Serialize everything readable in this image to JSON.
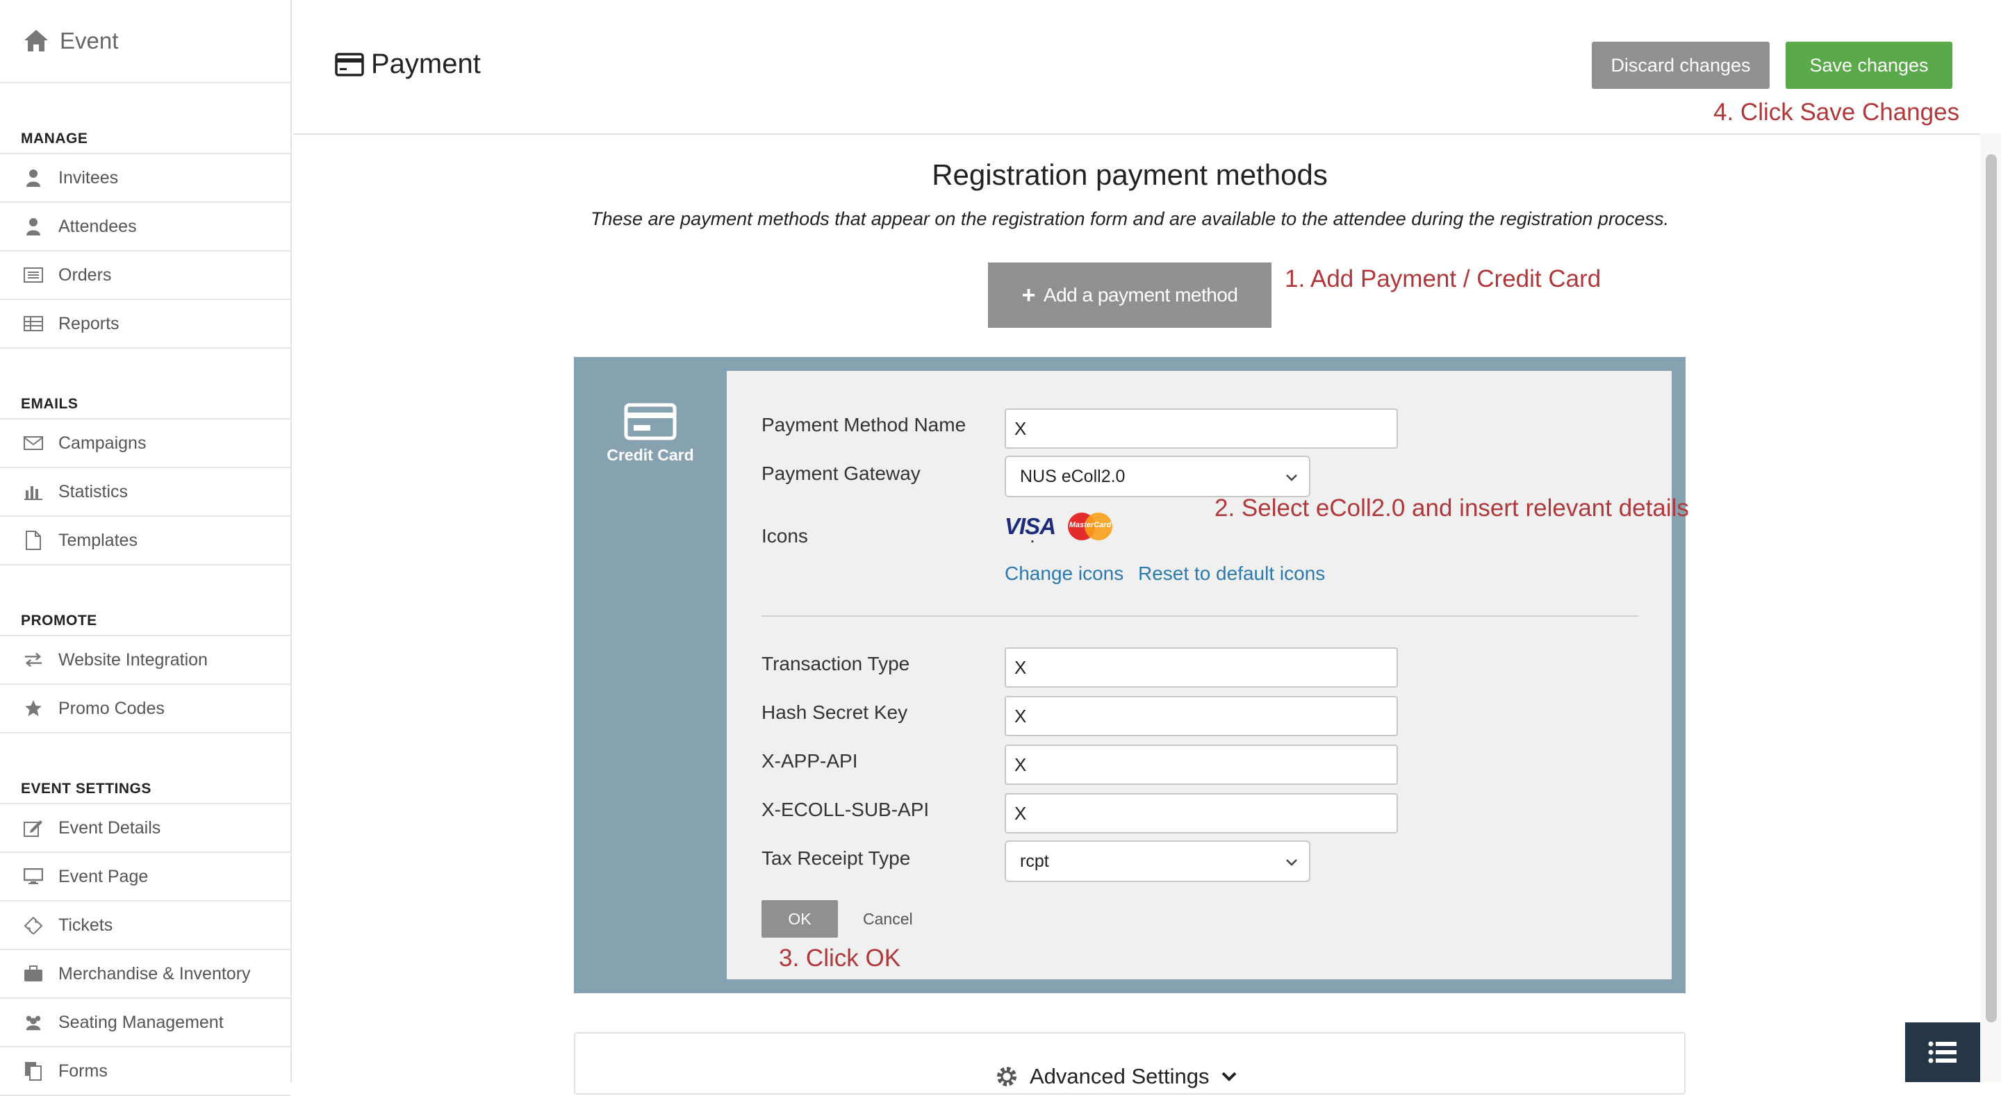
{
  "sidebar": {
    "brand": "Event",
    "sections": [
      {
        "title": "MANAGE",
        "items": [
          "Invitees",
          "Attendees",
          "Orders",
          "Reports"
        ]
      },
      {
        "title": "EMAILS",
        "items": [
          "Campaigns",
          "Statistics",
          "Templates"
        ]
      },
      {
        "title": "PROMOTE",
        "items": [
          "Website Integration",
          "Promo Codes"
        ]
      },
      {
        "title": "EVENT SETTINGS",
        "items": [
          "Event Details",
          "Event Page",
          "Tickets",
          "Merchandise & Inventory",
          "Seating Management",
          "Forms"
        ]
      }
    ]
  },
  "header": {
    "title": "Payment",
    "discard_label": "Discard changes",
    "save_label": "Save changes"
  },
  "annotations": {
    "step1": "1. Add Payment / Credit Card",
    "step2": "2. Select eColl2.0 and insert relevant details",
    "step3": "3. Click OK",
    "step4": "4. Click Save Changes"
  },
  "main": {
    "heading": "Registration payment methods",
    "description": "These are payment methods that appear on the registration form and are available to the attendee during the registration process.",
    "add_button": "Add a payment method",
    "method_tab_label": "Credit Card",
    "form": {
      "payment_method_name": {
        "label": "Payment Method Name",
        "value": "X"
      },
      "payment_gateway": {
        "label": "Payment Gateway",
        "value": "NUS eColl2.0"
      },
      "icons": {
        "label": "Icons",
        "visa": "VISA",
        "mastercard": "MasterCard",
        "change_link": "Change icons",
        "reset_link": "Reset to default icons"
      },
      "transaction_type": {
        "label": "Transaction Type",
        "value": "X"
      },
      "hash_secret_key": {
        "label": "Hash Secret Key",
        "value": "X"
      },
      "x_app_api": {
        "label": "X-APP-API",
        "value": "X"
      },
      "x_ecoll_sub_api": {
        "label": "X-ECOLL-SUB-API",
        "value": "X"
      },
      "tax_receipt_type": {
        "label": "Tax Receipt Type",
        "value": "rcpt"
      },
      "colon": ":",
      "ok_label": "OK",
      "cancel_label": "Cancel"
    },
    "advanced_settings": "Advanced Settings"
  },
  "colors": {
    "save_green": "#5aaa4b",
    "button_grey": "#909090",
    "annotation_red": "#b0373a",
    "panel_blue_grey": "#86a2b1",
    "link_blue": "#2a7ab0"
  }
}
